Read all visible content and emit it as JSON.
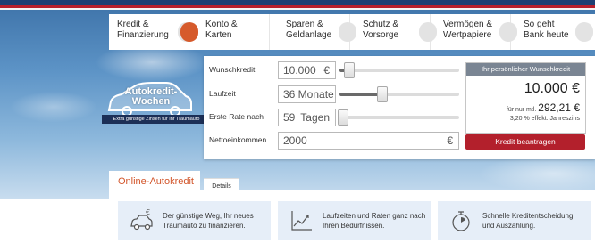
{
  "colors": {
    "accent_orange": "#d2552a",
    "brand_red": "#b3202c",
    "brand_navy": "#1c2f56"
  },
  "nav": {
    "items": [
      {
        "line1": "Kredit &",
        "line2": "Finanzierung"
      },
      {
        "line1": "Konto &",
        "line2": "Karten"
      },
      {
        "line1": "Sparen &",
        "line2": "Geldanlage"
      },
      {
        "line1": "Schutz &",
        "line2": "Vorsorge"
      },
      {
        "line1": "Vermögen &",
        "line2": "Wertpapiere"
      },
      {
        "line1": "So geht",
        "line2": "Bank heute"
      }
    ]
  },
  "logo": {
    "title_line1": "Autokredit-",
    "title_line2": "Wochen",
    "subtitle": "Extra günstige Zinsen für Ihr Traumauto",
    "icon": "car-outline-icon"
  },
  "calculator": {
    "wunschkredit": {
      "label": "Wunschkredit",
      "value": "10.000",
      "unit": "€",
      "slider_fraction": 0.05
    },
    "laufzeit": {
      "label": "Laufzeit",
      "value": "36 Monate",
      "slider_fraction": 0.33
    },
    "erste_rate": {
      "label": "Erste Rate nach",
      "value": "59",
      "unit": "Tagen",
      "slider_fraction": 0.0
    },
    "nettoeinkommen": {
      "label": "Nettoeinkommen",
      "value": "2000",
      "unit": "€"
    }
  },
  "summary": {
    "heading": "Ihr persönlicher Wunschkredit",
    "amount": "10.000 €",
    "monthly_prefix": "für nur mtl.",
    "monthly_value": "292,21 €",
    "rate": "3,20 % effekt. Jahreszins",
    "apply_label": "Kredit beantragen"
  },
  "lower": {
    "tab_active": "Online-Autokredit",
    "tab_details": "Details",
    "features": [
      {
        "icon": "car-euro-icon",
        "line1": "Der günstige Weg, Ihr neues",
        "line2": "Traumauto zu finanzieren."
      },
      {
        "icon": "chart-growth-icon",
        "line1": "Laufzeiten und Raten ganz nach",
        "line2": "Ihren Bedürfnissen."
      },
      {
        "icon": "stopwatch-icon",
        "line1": "Schnelle Kreditentscheidung",
        "line2": "und Auszahlung."
      }
    ]
  }
}
